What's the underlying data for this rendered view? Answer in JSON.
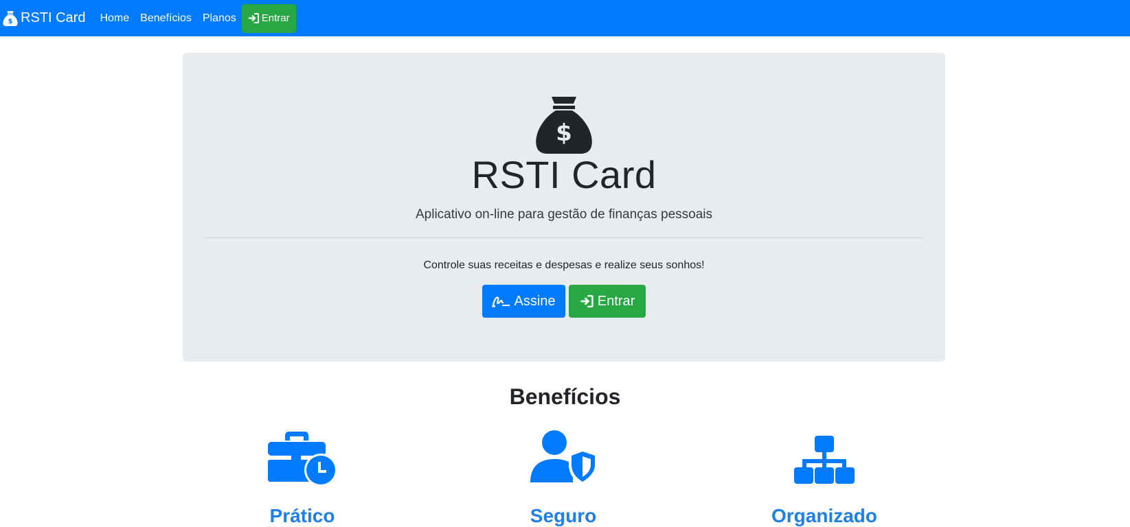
{
  "navbar": {
    "brand": "RSTI Card",
    "brand_icon": "money-bag-icon",
    "links": [
      "Home",
      "Benefícios",
      "Planos"
    ],
    "login_button": "Entrar",
    "bg_color": "#007bff"
  },
  "hero": {
    "icon": "money-bag-icon",
    "title": "RSTI Card",
    "subtitle": "Aplicativo on-line para gestão de finanças pessoais",
    "tagline": "Controle suas receitas e despesas e realize seus sonhos!",
    "subscribe_button": "Assine",
    "login_button": "Entrar"
  },
  "benefits": {
    "heading": "Benefícios",
    "items": [
      {
        "icon": "business-time-icon",
        "title": "Prático"
      },
      {
        "icon": "user-shield-icon",
        "title": "Seguro"
      },
      {
        "icon": "sitemap-icon",
        "title": "Organizado"
      }
    ],
    "accent_color": "#007bff"
  }
}
